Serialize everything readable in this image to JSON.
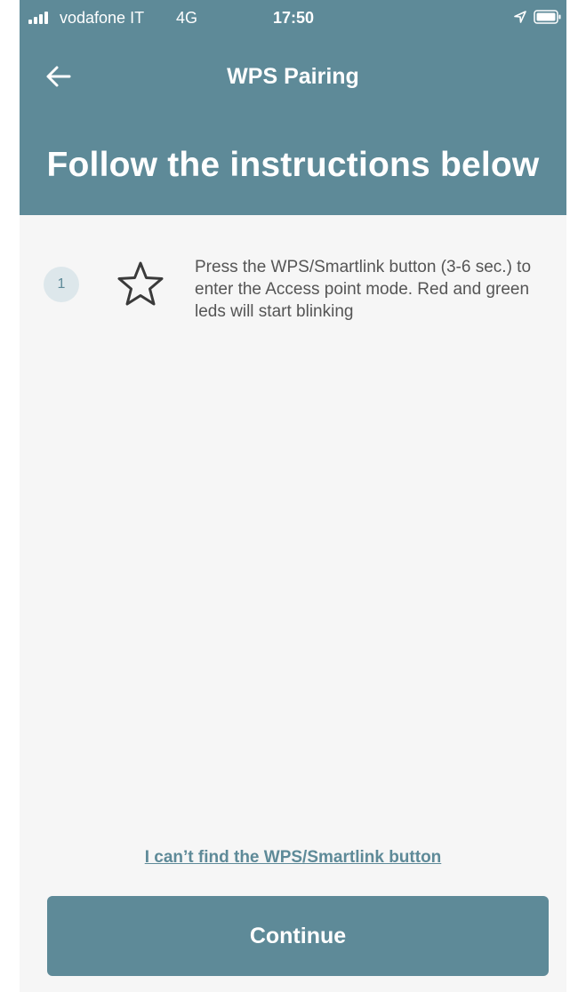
{
  "status_bar": {
    "carrier": "vodafone IT",
    "network": "4G",
    "time": "17:50",
    "icons": [
      "signal-icon",
      "location-icon",
      "battery-icon"
    ]
  },
  "nav": {
    "back_icon": "arrow-left-icon",
    "title": "WPS Pairing"
  },
  "heading": "Follow the instructions below",
  "steps": [
    {
      "number": "1",
      "icon": "star-icon",
      "text": "Press the WPS/Smartlink button (3-6 sec.) to enter the Access point mode. Red and green leds will start blinking"
    }
  ],
  "help_link": "I can’t find the WPS/Smartlink button",
  "continue_label": "Continue",
  "colors": {
    "primary": "#5e8a98",
    "background": "#f6f6f6",
    "step_badge": "#dde7eb",
    "text": "#555555"
  }
}
